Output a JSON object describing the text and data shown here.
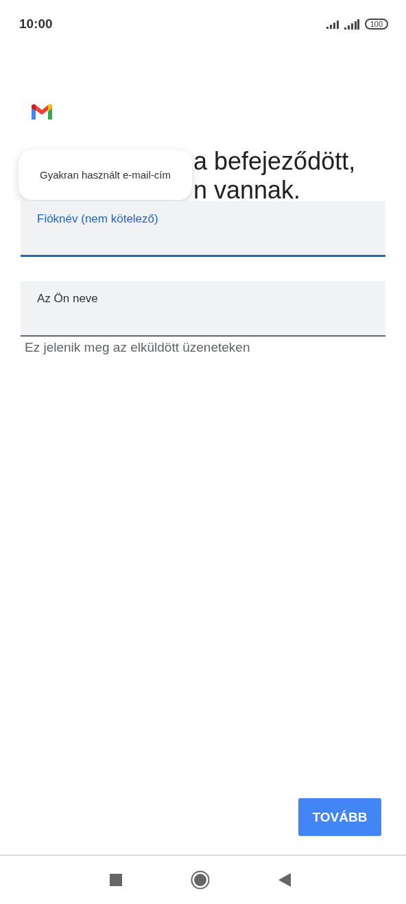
{
  "status_bar": {
    "time": "10:00",
    "battery": "100"
  },
  "heading_lines": [
    "a befejeződött,",
    "n vannak."
  ],
  "suggestion_popup": {
    "text": "Gyakran használt e-mail-cím"
  },
  "fields": [
    {
      "label": "Fióknév (nem kötelező)",
      "focused": true
    },
    {
      "label": "Az Ön neve",
      "focused": false,
      "helper": "Ez jelenik meg az elküldött üzeneteken"
    }
  ],
  "next_button": "TOVÁBB"
}
